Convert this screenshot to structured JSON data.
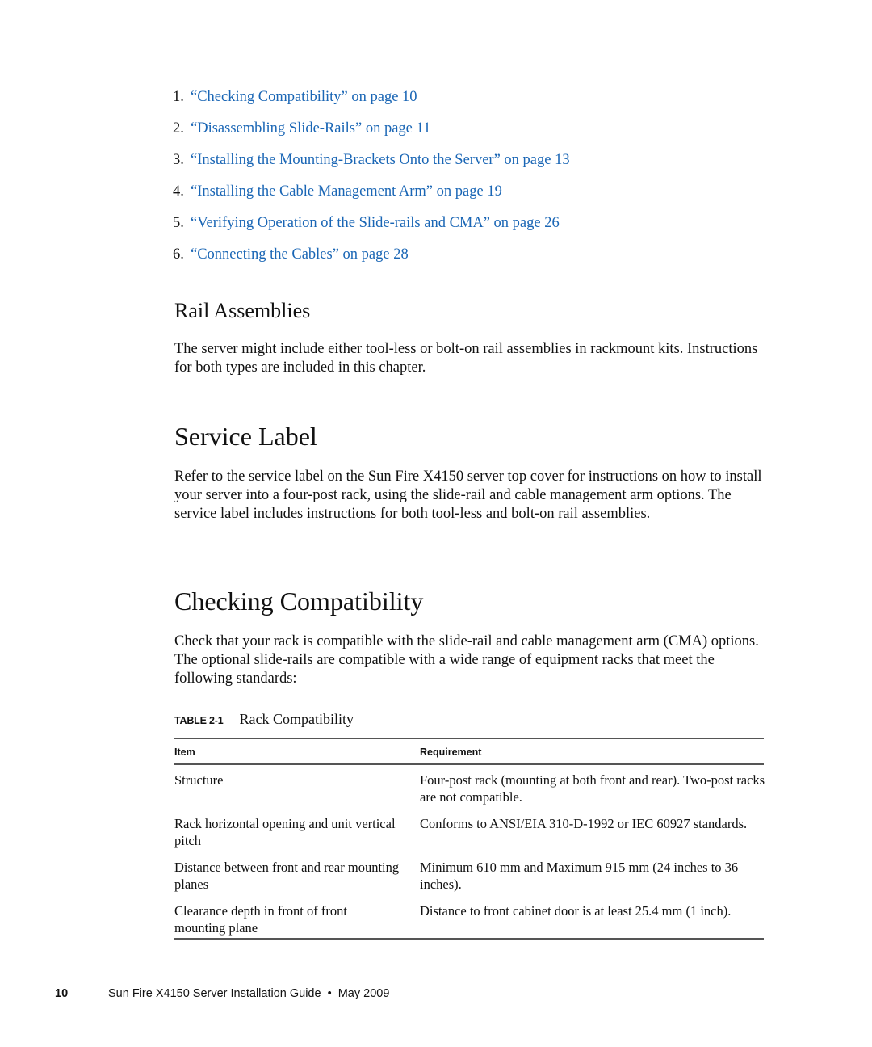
{
  "toc": [
    {
      "num": "1.",
      "label": "“Checking Compatibility” on page 10"
    },
    {
      "num": "2.",
      "label": "“Disassembling Slide-Rails” on page 11"
    },
    {
      "num": "3.",
      "label": "“Installing the Mounting-Brackets Onto the Server” on page 13"
    },
    {
      "num": "4.",
      "label": "“Installing the Cable Management Arm” on page 19"
    },
    {
      "num": "5.",
      "label": "“Verifying Operation of the Slide-rails and CMA” on page 26"
    },
    {
      "num": "6.",
      "label": "“Connecting the Cables” on page 28"
    }
  ],
  "rail_assemblies": {
    "heading": "Rail Assemblies",
    "body": "The server might include either tool-less or bolt-on rail assemblies in rackmount kits. Instructions for both types are included in this chapter."
  },
  "service_label": {
    "heading": "Service Label",
    "body": "Refer to the service label on the Sun Fire X4150 server top cover for instructions on how to install your server into a four-post rack, using the slide-rail and cable management arm options. The service label includes instructions for both tool-less and bolt-on rail assemblies."
  },
  "checking_compatibility": {
    "heading": "Checking Compatibility",
    "body": "Check that your rack is compatible with the slide-rail and cable management arm (CMA) options. The optional slide-rails are compatible with a wide range of equipment racks that meet the following standards:"
  },
  "table": {
    "label": "TABLE 2-1",
    "title": "Rack Compatibility",
    "headers": [
      "Item",
      "Requirement"
    ],
    "rows": [
      {
        "item": "Structure",
        "requirement": "Four-post rack (mounting at both front and rear). Two-post racks are not compatible."
      },
      {
        "item": "Rack horizontal opening and unit vertical pitch",
        "requirement": "Conforms to ANSI/EIA 310-D-1992 or IEC 60927 standards."
      },
      {
        "item": "Distance between front and rear mounting planes",
        "requirement": "Minimum 610 mm and Maximum 915 mm (24 inches to 36 inches)."
      },
      {
        "item": "Clearance depth in front of front mounting plane",
        "requirement": "Distance to front cabinet door is at least 25.4 mm (1 inch)."
      }
    ]
  },
  "footer": {
    "page_number": "10",
    "title": "Sun Fire X4150 Server Installation Guide",
    "separator": "•",
    "date": "May 2009"
  }
}
